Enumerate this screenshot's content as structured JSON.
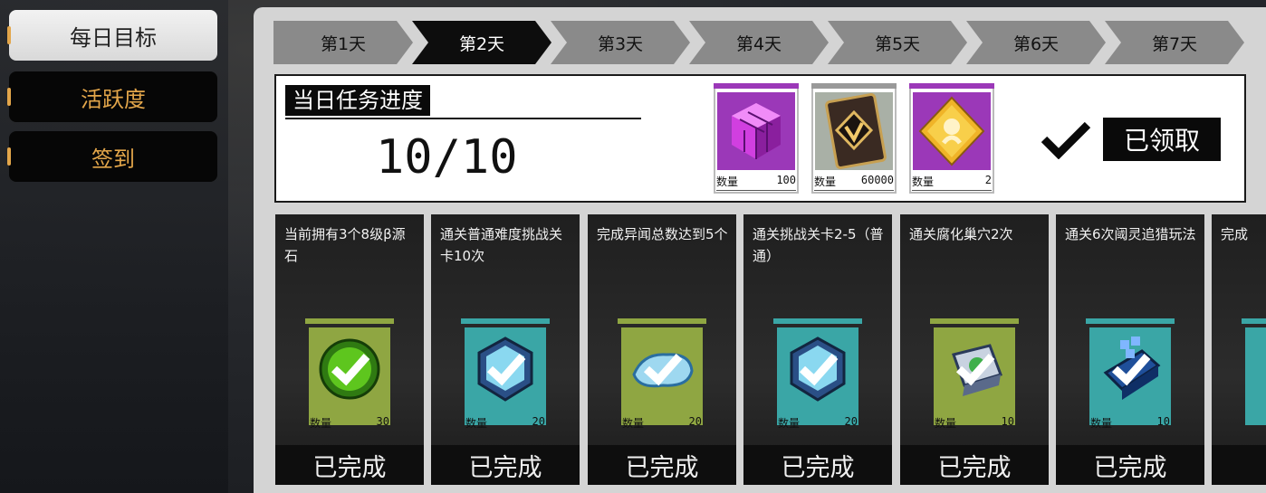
{
  "sidebar": {
    "items": [
      {
        "label": "每日目标",
        "active": true
      },
      {
        "label": "活跃度",
        "active": false
      },
      {
        "label": "签到",
        "active": false
      }
    ]
  },
  "days": {
    "tabs": [
      "第1天",
      "第2天",
      "第3天",
      "第4天",
      "第5天",
      "第6天",
      "第7天"
    ],
    "active_index": 1
  },
  "progress": {
    "title": "当日任务进度",
    "value": "10/10",
    "rewards": [
      {
        "icon": "purple-cube-icon",
        "qty_label": "数量",
        "qty": "100",
        "color": "#9b38b8"
      },
      {
        "icon": "coin-card-icon",
        "qty_label": "数量",
        "qty": "60000",
        "color": "#a9b0a6"
      },
      {
        "icon": "gold-card-icon",
        "qty_label": "数量",
        "qty": "2",
        "color": "#9b38b8"
      }
    ],
    "claimed_label": "已领取"
  },
  "tasks": [
    {
      "title": "当前拥有3个8级β源石",
      "qty_label": "数量",
      "qty": "30",
      "status": "已完成",
      "icon": "green-orb-icon",
      "tile_color": "#8fa642"
    },
    {
      "title": "通关普通难度挑战关卡10次",
      "qty_label": "数量",
      "qty": "20",
      "status": "已完成",
      "icon": "blue-crystal-icon",
      "tile_color": "#3aa6a6"
    },
    {
      "title": "完成异闻总数达到5个",
      "qty_label": "数量",
      "qty": "20",
      "status": "已完成",
      "icon": "ice-shard-icon",
      "tile_color": "#8fa642"
    },
    {
      "title": "通关挑战关卡2-5（普通）",
      "qty_label": "数量",
      "qty": "20",
      "status": "已完成",
      "icon": "blue-crystal-icon",
      "tile_color": "#3aa6a6"
    },
    {
      "title": "通关腐化巢穴2次",
      "qty_label": "数量",
      "qty": "10",
      "status": "已完成",
      "icon": "chip-icon",
      "tile_color": "#8fa642"
    },
    {
      "title": "通关6次阈灵追猎玩法",
      "qty_label": "数量",
      "qty": "10",
      "status": "已完成",
      "icon": "circuit-icon",
      "tile_color": "#3aa6a6"
    },
    {
      "title": "完成",
      "qty_label": "",
      "qty": "",
      "status": "",
      "icon": "",
      "tile_color": "#3aa6a6"
    }
  ]
}
